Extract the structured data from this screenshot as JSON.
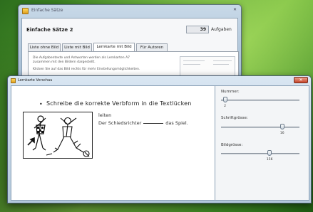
{
  "back_window": {
    "title": "Einfache Sätze",
    "heading": "Einfache Sätze 2",
    "task_count": "39",
    "task_count_label": "Aufgaben",
    "tabs": [
      {
        "label": "Liste ohne Bild",
        "active": false
      },
      {
        "label": "Liste mit Bild",
        "active": false
      },
      {
        "label": "Lernkarte mit Bild",
        "active": true
      },
      {
        "label": "Für Autoren",
        "active": false
      }
    ],
    "note_line1": "Die Aufgabentexte und Antworten werden als Lernkarten A7",
    "note_line2": "zusammen mit den Bildern dargestellt.",
    "note_line3": "Klicken Sie auf das Bild rechts für mehr Einstellungsmöglichkeiten."
  },
  "front_window": {
    "title": "Lernkarte Vorschau",
    "close_symbol": "✕",
    "card": {
      "bullet": "•",
      "task_title": "Schreibe die korrekte Verbform in die Textlücken",
      "word": "leiten",
      "sentence_before": "Der Schiedsrichter",
      "sentence_after": "das Spiel.",
      "image_icon": "referee-soccer-drawing-icon"
    },
    "sliders": [
      {
        "label": "Nummer:",
        "value": "2",
        "fraction": 0.05
      },
      {
        "label": "Schriftgrösse:",
        "value": "16",
        "fraction": 0.78
      },
      {
        "label": "Bildgrösse:",
        "value": "156",
        "fraction": 0.62
      }
    ]
  },
  "colors": {
    "accent_close": "#c7452a",
    "window_frame": "#b4c9dc",
    "desktop": "#4f9a2c"
  }
}
